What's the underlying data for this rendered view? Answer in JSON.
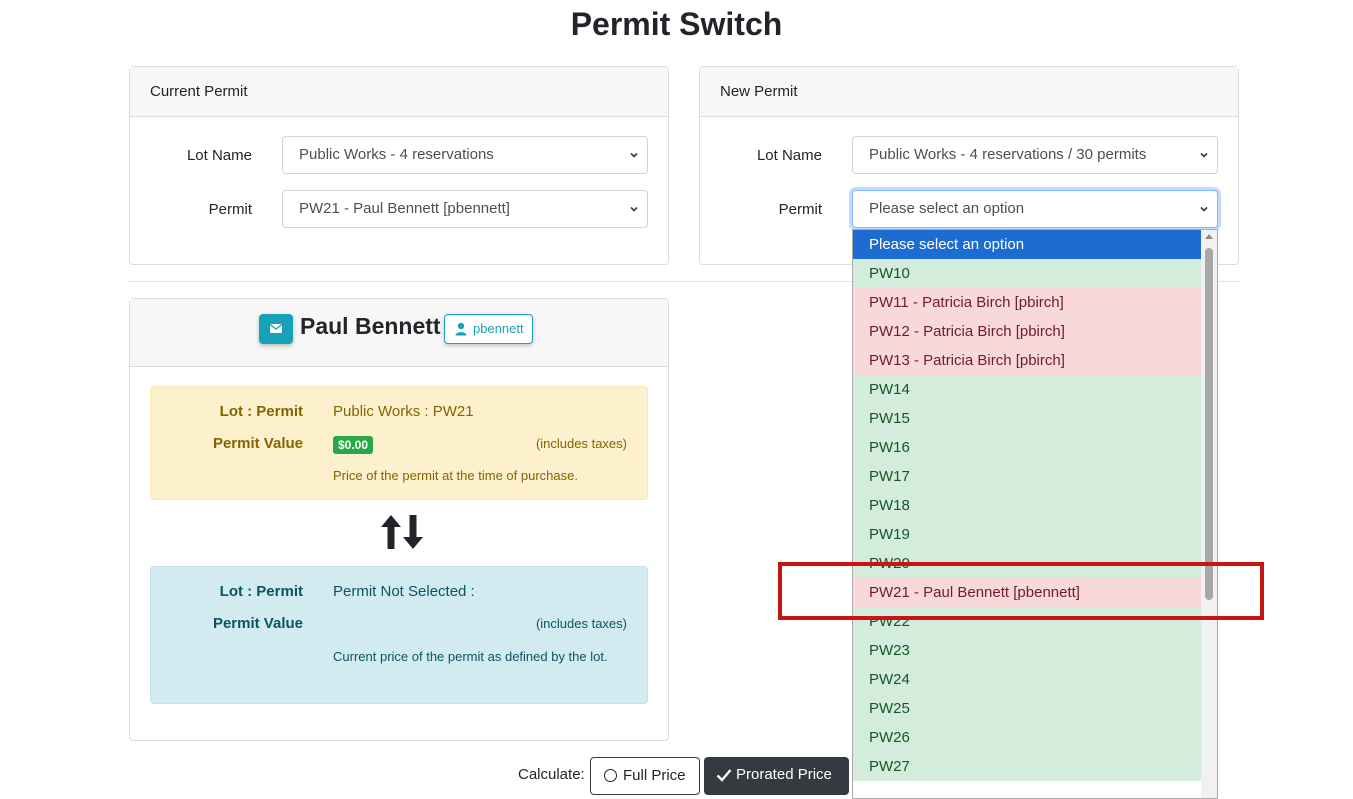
{
  "page": {
    "title": "Permit Switch"
  },
  "current_permit": {
    "header": "Current Permit",
    "lot_name_label": "Lot Name",
    "lot_name_value": "Public Works - 4 reservations",
    "permit_label": "Permit",
    "permit_value": "PW21 - Paul Bennett [pbennett]"
  },
  "new_permit": {
    "header": "New Permit",
    "lot_name_label": "Lot Name",
    "lot_name_value": "Public Works - 4 reservations / 30 permits",
    "permit_label": "Permit",
    "permit_value": "Please select an option"
  },
  "user": {
    "name": "Paul Bennett",
    "username": "pbennett",
    "icons": {
      "mail": "envelope-icon",
      "user": "user-icon"
    }
  },
  "current_box": {
    "lot_permit_label": "Lot : Permit",
    "lot_permit_value": "Public Works  : PW21",
    "permit_value_label": "Permit Value",
    "price": "$0.00",
    "includes_taxes": "(includes taxes)",
    "note": "Price of the permit at the time of purchase."
  },
  "new_box": {
    "lot_permit_label": "Lot : Permit",
    "lot_permit_value": "Permit Not Selected  :",
    "permit_value_label": "Permit Value",
    "includes_taxes": "(includes taxes)",
    "note": "Current price of the permit as defined by the lot."
  },
  "calculate": {
    "label": "Calculate:",
    "full_price": "Full Price",
    "prorated_price": "Prorated Price"
  },
  "dropdown_options": [
    {
      "label": "Please select an option",
      "state": "selected"
    },
    {
      "label": "PW10",
      "state": "available"
    },
    {
      "label": "PW11 - Patricia Birch [pbirch]",
      "state": "taken"
    },
    {
      "label": "PW12 - Patricia Birch [pbirch]",
      "state": "taken"
    },
    {
      "label": "PW13 - Patricia Birch [pbirch]",
      "state": "taken"
    },
    {
      "label": "PW14",
      "state": "available"
    },
    {
      "label": "PW15",
      "state": "available"
    },
    {
      "label": "PW16",
      "state": "available"
    },
    {
      "label": "PW17",
      "state": "available"
    },
    {
      "label": "PW18",
      "state": "available"
    },
    {
      "label": "PW19",
      "state": "available"
    },
    {
      "label": "PW20",
      "state": "available"
    },
    {
      "label": "PW21 - Paul Bennett [pbennett]",
      "state": "taken"
    },
    {
      "label": "PW22",
      "state": "available"
    },
    {
      "label": "PW23",
      "state": "available"
    },
    {
      "label": "PW24",
      "state": "available"
    },
    {
      "label": "PW25",
      "state": "available"
    },
    {
      "label": "PW26",
      "state": "available"
    },
    {
      "label": "PW27",
      "state": "available"
    }
  ],
  "colors": {
    "available": "#d4ecdb",
    "taken": "#f7d8db",
    "selected": "#1c6cd1",
    "annotation": "#c71414"
  }
}
